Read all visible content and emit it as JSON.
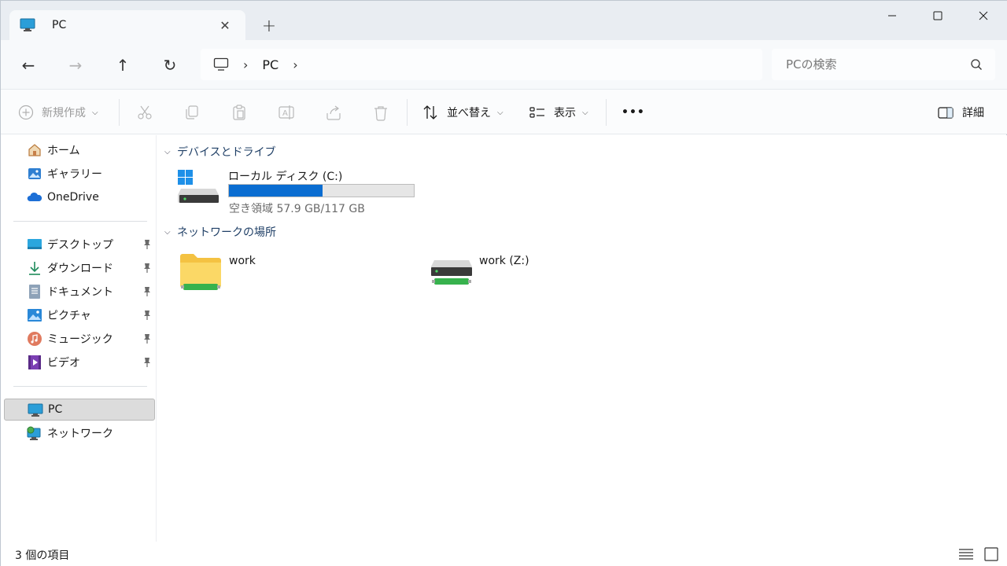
{
  "window": {
    "tab_title": "PC",
    "close_tab_glyph": "✕",
    "new_tab_glyph": "+"
  },
  "navigation": {
    "back_glyph": "←",
    "forward_glyph": "→",
    "up_glyph": "↑",
    "refresh_glyph": "↻",
    "breadcrumb": [
      "PC"
    ],
    "separator_glyph": "›"
  },
  "search": {
    "placeholder": "PCの検索"
  },
  "toolbar": {
    "new_label": "新規作成",
    "sort_label": "並べ替え",
    "view_label": "表示",
    "more_glyph": "•••",
    "details_label": "詳細",
    "chevron_glyph": "⌵"
  },
  "sidebar": {
    "items": [
      {
        "label": "ホーム",
        "icon": "home-icon",
        "pinned": false
      },
      {
        "label": "ギャラリー",
        "icon": "gallery-icon",
        "pinned": false
      },
      {
        "label": "OneDrive",
        "icon": "onedrive-icon",
        "pinned": false
      }
    ],
    "quick_access": [
      {
        "label": "デスクトップ",
        "icon": "desktop-icon",
        "pinned": true
      },
      {
        "label": "ダウンロード",
        "icon": "download-icon",
        "pinned": true
      },
      {
        "label": "ドキュメント",
        "icon": "documents-icon",
        "pinned": true
      },
      {
        "label": "ピクチャ",
        "icon": "pictures-icon",
        "pinned": true
      },
      {
        "label": "ミュージック",
        "icon": "music-icon",
        "pinned": true
      },
      {
        "label": "ビデオ",
        "icon": "videos-icon",
        "pinned": true
      }
    ],
    "locations": [
      {
        "label": "PC",
        "icon": "pc-icon",
        "selected": true
      },
      {
        "label": "ネットワーク",
        "icon": "network-icon",
        "selected": false
      }
    ]
  },
  "content": {
    "groups": [
      {
        "title": "デバイスとドライブ",
        "items": [
          {
            "name": "ローカル ディスク (C:)",
            "free_text": "空き領域 57.9 GB/117 GB",
            "used_fraction": 0.505
          }
        ]
      },
      {
        "title": "ネットワークの場所",
        "items": [
          {
            "name": "work"
          },
          {
            "name": "work (Z:)"
          }
        ]
      }
    ]
  },
  "status": {
    "item_count": "3 個の項目"
  },
  "colors": {
    "accent": "#0a6dd1",
    "selection": "#dcdcdc"
  }
}
